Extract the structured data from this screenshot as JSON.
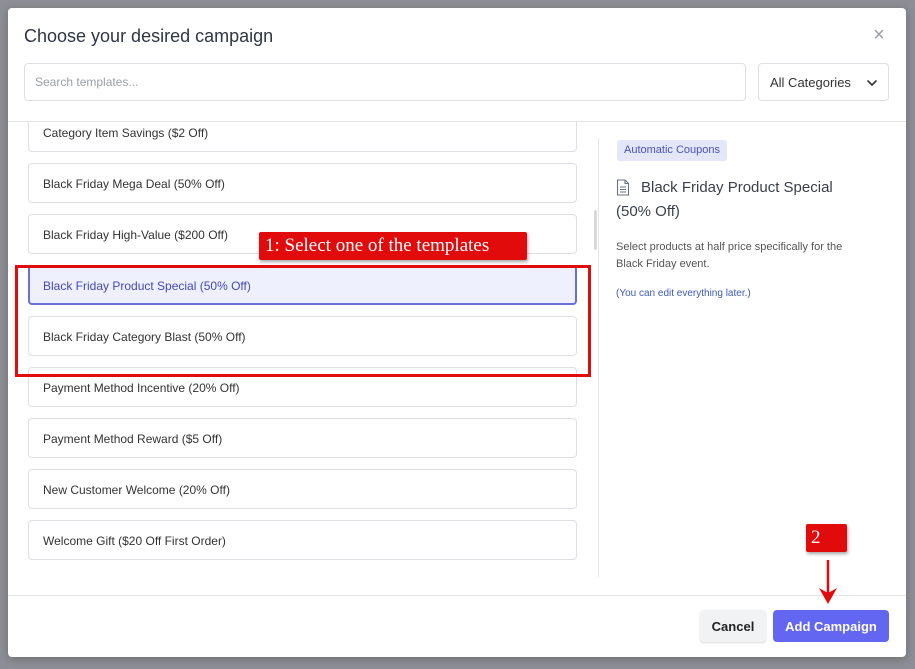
{
  "dialog": {
    "title": "Choose your desired campaign",
    "close_glyph": "×"
  },
  "search": {
    "placeholder": "Search templates...",
    "value": ""
  },
  "category_select": {
    "selected": "All Categories"
  },
  "templates": [
    {
      "label": "Category Item Savings ($2 Off)",
      "selected": false
    },
    {
      "label": "Black Friday Mega Deal (50% Off)",
      "selected": false
    },
    {
      "label": "Black Friday High-Value ($200 Off)",
      "selected": false
    },
    {
      "label": "Black Friday Product Special (50% Off)",
      "selected": true
    },
    {
      "label": "Black Friday Category Blast (50% Off)",
      "selected": false
    },
    {
      "label": "Payment Method Incentive (20% Off)",
      "selected": false
    },
    {
      "label": "Payment Method Reward ($5 Off)",
      "selected": false
    },
    {
      "label": "New Customer Welcome (20% Off)",
      "selected": false
    },
    {
      "label": "Welcome Gift ($20 Off First Order)",
      "selected": false
    }
  ],
  "detail": {
    "badge": "Automatic Coupons",
    "icon": "document-icon",
    "title": "Black Friday Product Special (50% Off)",
    "description": "Select products at half price specifically for the Black Friday event.",
    "note": "(You can edit everything later.)"
  },
  "footer": {
    "cancel_label": "Cancel",
    "add_label": "Add Campaign"
  },
  "annotations": {
    "step1": "1: Select one of the templates",
    "step2": "2"
  },
  "colors": {
    "accent": "#6366f1",
    "annotation_red": "#e10b0b",
    "selected_bg": "#eef1fd"
  }
}
